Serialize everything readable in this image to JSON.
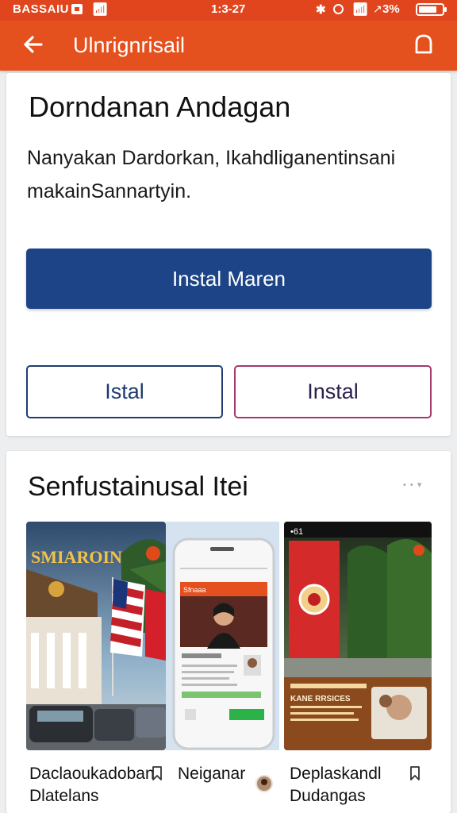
{
  "status_bar": {
    "carrier": "BASSAIU",
    "time": "1:3-27",
    "battery_text": "3%"
  },
  "app_bar": {
    "title": "Ulnrignrisail",
    "back_icon": "arrow-left-icon",
    "action_icon": "bell-icon"
  },
  "intro_card": {
    "heading": "Dorndanan Andagan",
    "description": "Nanyakan Dardorkan, Ikahdliganentinsani makainSannartyin.",
    "primary_button": "Instal Maren",
    "secondary_button_left": "Istal",
    "secondary_button_right": "Instal"
  },
  "gallery": {
    "section_title": "Senfustainusal Itei",
    "more_icon": "chevron-down-icon",
    "items": [
      {
        "overlay_text": "SMIAROIN",
        "caption": "Daclaoukadoban Dlatelans",
        "icon": "bookmark-icon"
      },
      {
        "overlay_text": "Sfnaaa",
        "caption": "Neiganar",
        "icon": "avatar"
      },
      {
        "overlay_text": "KANE RRSICES",
        "caption": "Deplaskandl Dudangas",
        "icon": "bookmark-icon"
      }
    ]
  },
  "colors": {
    "app_bar": "#e4511f",
    "primary_button": "#1c4486",
    "outline_left": "#1f3e6f",
    "outline_right": "#a33a6e"
  }
}
